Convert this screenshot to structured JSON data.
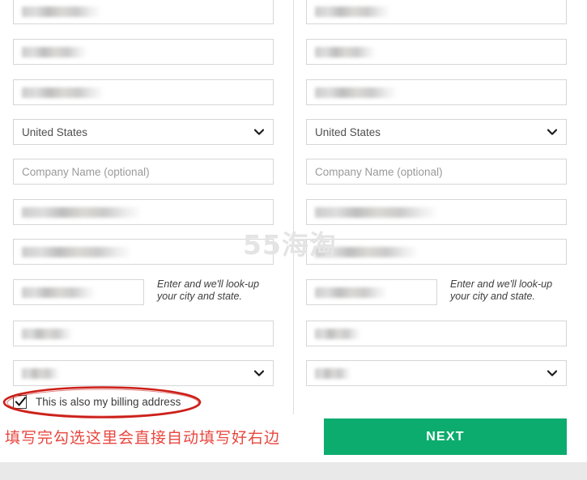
{
  "page": {
    "watermark": "55海淘",
    "annotation": "填写完勾选这里会直接自动填写好右边",
    "hint_text": "Enter and we'll look-up your city and state.",
    "checkbox_label": "This is also my billing address",
    "next_label": "NEXT",
    "country_value": "United States",
    "company_placeholder": "Company Name (optional)",
    "accent_green": "#0cac6e",
    "annotation_red": "#e8473f",
    "ellipse_red": "#cc1f19"
  },
  "shipping_form": {
    "rows": [
      {
        "type": "text",
        "redacted": true,
        "blur_width": 96
      },
      {
        "type": "text",
        "redacted": true,
        "blur_width": 80
      },
      {
        "type": "text",
        "redacted": true,
        "blur_width": 100
      },
      {
        "type": "select",
        "redacted": false,
        "value": "United States"
      },
      {
        "type": "text",
        "redacted": false,
        "placeholder": "Company Name (optional)"
      },
      {
        "type": "text",
        "redacted": true,
        "blur_width": 146
      },
      {
        "type": "text",
        "redacted": true,
        "blur_width": 134
      },
      {
        "type": "zip",
        "redacted": true,
        "blur_width": 90
      },
      {
        "type": "text",
        "redacted": true,
        "blur_width": 62
      },
      {
        "type": "select",
        "redacted": true,
        "blur_width": 46
      }
    ]
  },
  "billing_form": {
    "rows": [
      {
        "type": "text",
        "redacted": true,
        "blur_width": 92
      },
      {
        "type": "text",
        "redacted": true,
        "blur_width": 74
      },
      {
        "type": "text",
        "redacted": true,
        "blur_width": 100
      },
      {
        "type": "select",
        "redacted": false,
        "value": "United States"
      },
      {
        "type": "text",
        "redacted": false,
        "placeholder": "Company Name (optional)"
      },
      {
        "type": "text",
        "redacted": true,
        "blur_width": 150
      },
      {
        "type": "text",
        "redacted": true,
        "blur_width": 126
      },
      {
        "type": "zip",
        "redacted": true,
        "blur_width": 88
      },
      {
        "type": "text",
        "redacted": true,
        "blur_width": 56
      },
      {
        "type": "select",
        "redacted": true,
        "blur_width": 44
      }
    ]
  }
}
